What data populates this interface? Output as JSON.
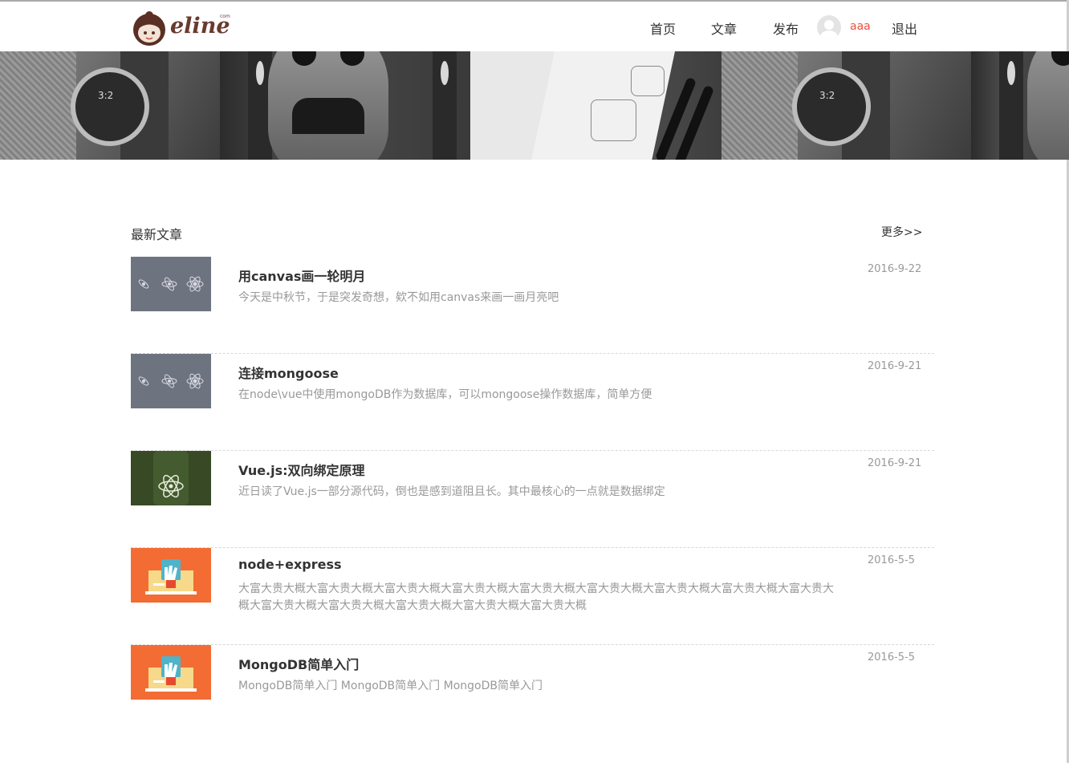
{
  "header": {
    "logo_text": "eline",
    "logo_suffix": "com",
    "nav": [
      {
        "label": "首页"
      },
      {
        "label": "文章"
      },
      {
        "label": "发布"
      }
    ],
    "username": "aaa",
    "username_color": "#e8533f",
    "logout_label": "退出"
  },
  "banner": {
    "images": [
      "smartwatch-photo",
      "tiki-mask-photo",
      "sketchbook-photo",
      "smartwatch-photo",
      "tiki-mask-photo"
    ],
    "watch_time": "3:2"
  },
  "articles_section": {
    "title": "最新文章",
    "more_label": "更多>>",
    "articles": [
      {
        "title": "用canvas画一轮明月",
        "description": "今天是中秋节，于是突发奇想，欸不如用canvas来画一画月亮吧",
        "date": "2016-9-22",
        "thumbnail": "react-atoms-slate"
      },
      {
        "title": "连接mongoose",
        "description": "在node\\vue中使用mongoDB作为数据库，可以mongoose操作数据库，简单方便",
        "date": "2016-9-21",
        "thumbnail": "react-atoms-slate"
      },
      {
        "title": "Vue.js:双向绑定原理",
        "description": "近日读了Vue.js一部分源代码，倒也是感到道阻且长。其中最核心的一点就是数据绑定",
        "date": "2016-9-21",
        "thumbnail": "react-atom-green"
      },
      {
        "title": "node+express",
        "description": "大富大贵大概大富大贵大概大富大贵大概大富大贵大概大富大贵大概大富大贵大概大富大贵大概大富大贵大概大富大贵大概大富大贵大概大富大贵大概大富大贵大概大富大贵大概大富大贵大概",
        "date": "2016-5-5",
        "thumbnail": "hand-box-orange"
      },
      {
        "title": "MongoDB简单入门",
        "description": "MongoDB简单入门 MongoDB简单入门 MongoDB简单入门",
        "date": "2016-5-5",
        "thumbnail": "hand-box-orange"
      }
    ]
  }
}
